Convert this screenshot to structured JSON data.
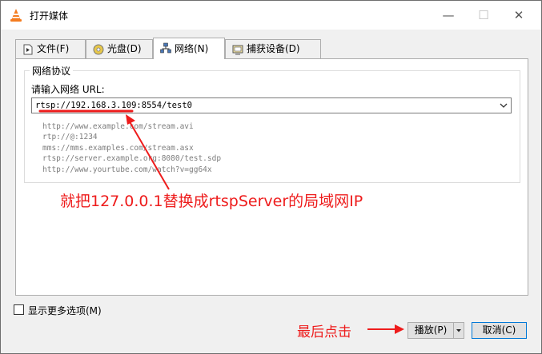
{
  "window": {
    "title": "打开媒体",
    "minimize_glyph": "—",
    "maximize_glyph": "☐",
    "close_glyph": "✕",
    "app_icon": "vlc-cone-icon"
  },
  "tabs": [
    {
      "label": "文件(F)",
      "icon": "file-play-icon",
      "active": false
    },
    {
      "label": "光盘(D)",
      "icon": "disc-icon",
      "active": false
    },
    {
      "label": "网络(N)",
      "icon": "network-icon",
      "active": true
    },
    {
      "label": "捕获设备(D)",
      "icon": "capture-device-icon",
      "active": false
    }
  ],
  "network": {
    "group_title": "网络协议",
    "url_label": "请输入网络 URL:",
    "url_value": "rtsp://192.168.3.109:8554/test0",
    "examples": [
      "http://www.example.com/stream.avi",
      "rtp://@:1234",
      "mms://mms.examples.com/stream.asx",
      "rtsp://server.example.org:8080/test.sdp",
      "http://www.yourtube.com/watch?v=gg64x"
    ]
  },
  "annotations": {
    "replace_ip_note": "就把127.0.0.1替换成rtspServer的局域网IP",
    "click_note": "最后点击",
    "color": "#ee1c1c"
  },
  "footer": {
    "more_options_label": "显示更多选项(M)",
    "more_options_checked": false,
    "play_label": "播放(P)",
    "cancel_label": "取消(C)"
  },
  "colors": {
    "accent": "#0078d7",
    "vlc_orange": "#f47c20"
  }
}
